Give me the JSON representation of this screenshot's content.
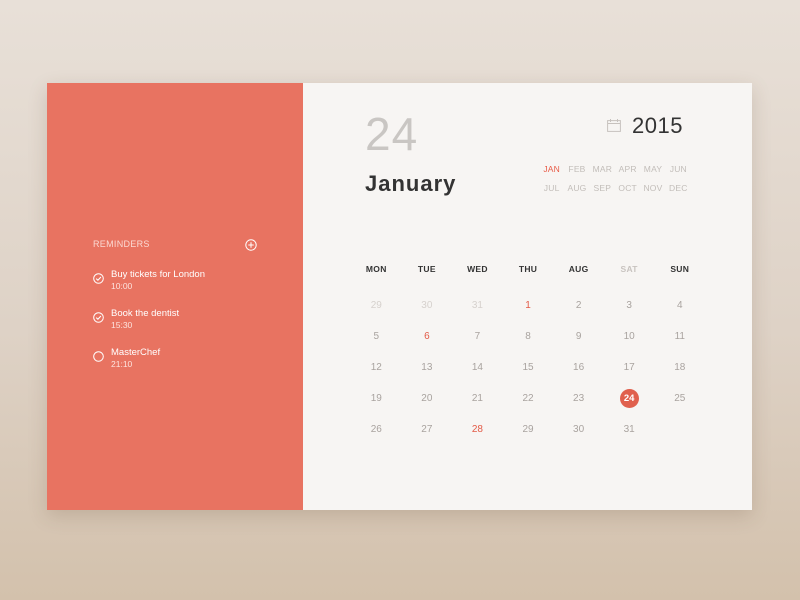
{
  "reminders": {
    "title": "REMINDERS",
    "items": [
      {
        "name": "Buy tickets for London",
        "time": "10:00",
        "done": true
      },
      {
        "name": "Book the dentist",
        "time": "15:30",
        "done": true
      },
      {
        "name": "MasterChef",
        "time": "21:10",
        "done": false
      }
    ]
  },
  "header": {
    "day": "24",
    "month": "January",
    "year": "2015"
  },
  "months": [
    "JAN",
    "FEB",
    "MAR",
    "APR",
    "MAY",
    "JUN",
    "JUL",
    "AUG",
    "SEP",
    "OCT",
    "NOV",
    "DEC"
  ],
  "active_month": "JAN",
  "weekdays": [
    "MON",
    "TUE",
    "WED",
    "THU",
    "AUG",
    "SAT",
    "SUN"
  ],
  "weeks": [
    [
      {
        "d": "29",
        "s": "outside"
      },
      {
        "d": "30",
        "s": "outside"
      },
      {
        "d": "31",
        "s": "outside"
      },
      {
        "d": "1",
        "s": "red"
      },
      {
        "d": "2",
        "s": ""
      },
      {
        "d": "3",
        "s": ""
      },
      {
        "d": "4",
        "s": ""
      }
    ],
    [
      {
        "d": "5",
        "s": ""
      },
      {
        "d": "6",
        "s": "red"
      },
      {
        "d": "7",
        "s": ""
      },
      {
        "d": "8",
        "s": ""
      },
      {
        "d": "9",
        "s": ""
      },
      {
        "d": "10",
        "s": ""
      },
      {
        "d": "11",
        "s": ""
      }
    ],
    [
      {
        "d": "12",
        "s": ""
      },
      {
        "d": "13",
        "s": ""
      },
      {
        "d": "14",
        "s": ""
      },
      {
        "d": "15",
        "s": ""
      },
      {
        "d": "16",
        "s": ""
      },
      {
        "d": "17",
        "s": ""
      },
      {
        "d": "18",
        "s": ""
      }
    ],
    [
      {
        "d": "19",
        "s": ""
      },
      {
        "d": "20",
        "s": ""
      },
      {
        "d": "21",
        "s": ""
      },
      {
        "d": "22",
        "s": ""
      },
      {
        "d": "23",
        "s": ""
      },
      {
        "d": "24",
        "s": "selected"
      },
      {
        "d": "25",
        "s": ""
      }
    ],
    [
      {
        "d": "26",
        "s": ""
      },
      {
        "d": "27",
        "s": ""
      },
      {
        "d": "28",
        "s": "red"
      },
      {
        "d": "29",
        "s": ""
      },
      {
        "d": "30",
        "s": ""
      },
      {
        "d": "31",
        "s": ""
      },
      {
        "d": "",
        "s": ""
      }
    ]
  ],
  "colors": {
    "accent": "#e87361",
    "highlight": "#e35a46"
  },
  "icons": {
    "add": "plus-circle-icon",
    "check": "check-circle-icon",
    "unchecked": "empty-circle-icon",
    "calendar": "calendar-icon"
  }
}
